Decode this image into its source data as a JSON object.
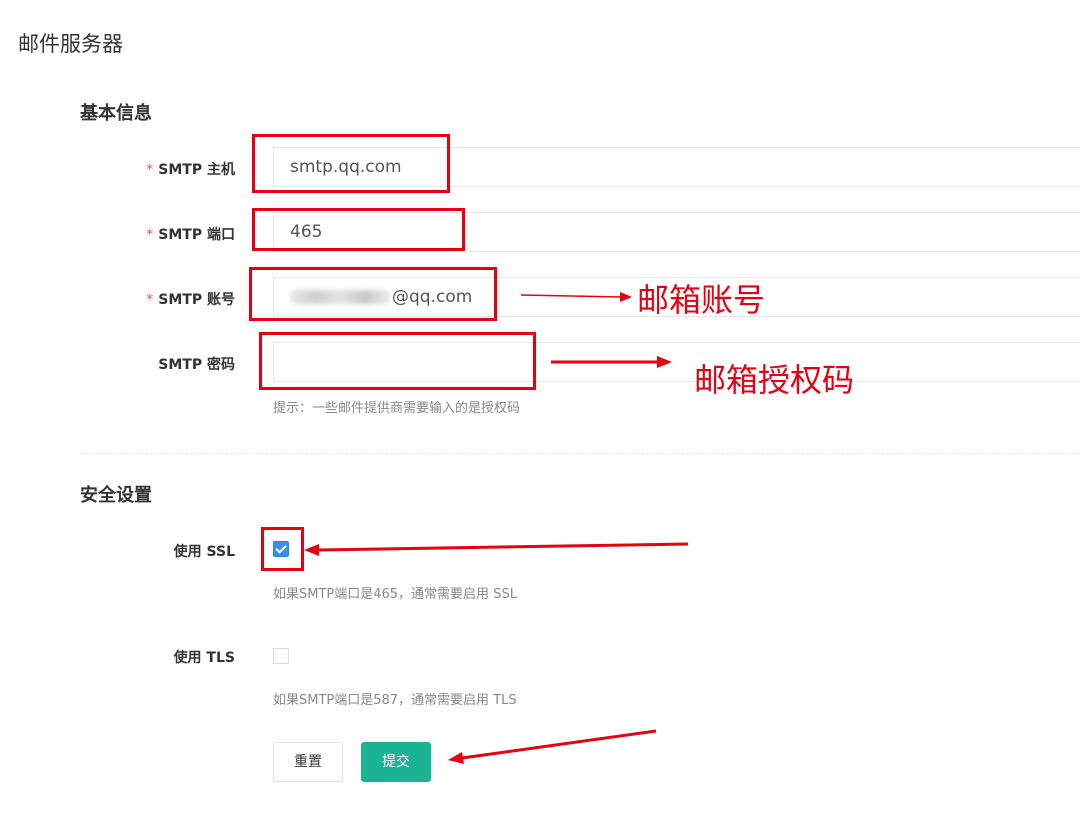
{
  "page": {
    "title": "邮件服务器"
  },
  "basic": {
    "section_title": "基本信息",
    "host": {
      "required_mark": "*",
      "label": "SMTP 主机",
      "value": "smtp.qq.com"
    },
    "port": {
      "required_mark": "*",
      "label": "SMTP 端口",
      "value": "465"
    },
    "account": {
      "required_mark": "*",
      "label": "SMTP 账号",
      "value_suffix": "@qq.com"
    },
    "password": {
      "label": "SMTP 密码",
      "value": "",
      "help": "提示：一些邮件提供商需要输入的是授权码"
    }
  },
  "security": {
    "section_title": "安全设置",
    "ssl": {
      "label": "使用 SSL",
      "checked": true,
      "help": "如果SMTP端口是465，通常需要启用 SSL"
    },
    "tls": {
      "label": "使用 TLS",
      "checked": false,
      "help": "如果SMTP端口是587，通常需要启用 TLS"
    }
  },
  "actions": {
    "reset_label": "重置",
    "submit_label": "提交"
  },
  "annotations": {
    "account_note": "邮箱账号",
    "password_note": "邮箱授权码",
    "color": "#e60012"
  }
}
